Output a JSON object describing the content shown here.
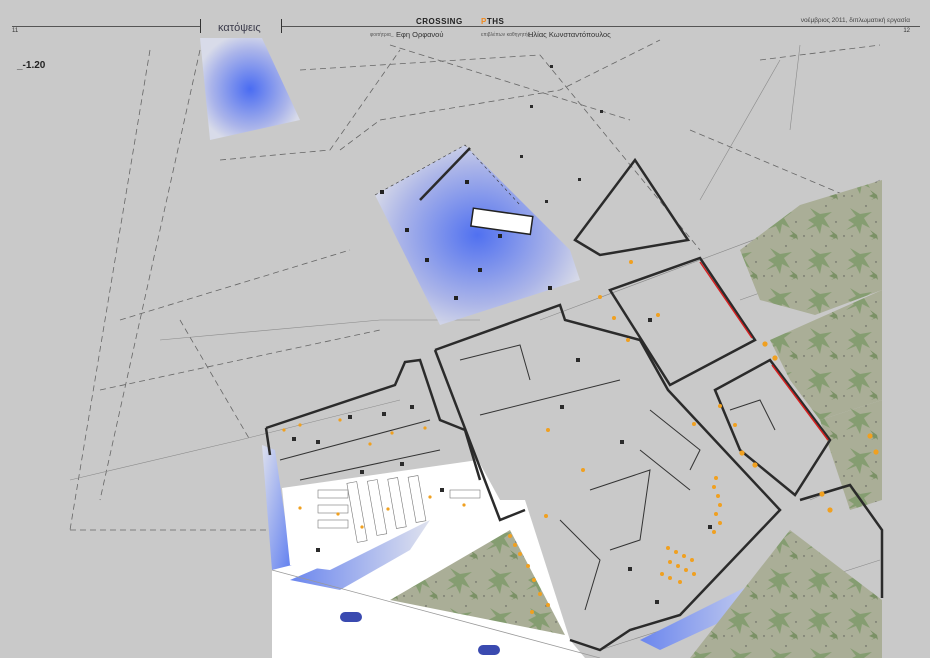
{
  "header": {
    "page_left": "11",
    "page_right": "12",
    "section_title": "κατόψεις",
    "project_word1": "CROSSING",
    "project_word2_prefix": "P",
    "project_word2_rest": "THS",
    "student_label": "φοιτήτρια_",
    "student_name": "Εφη Ορφανού",
    "supervisor_label": "επιβλέπων καθηγητής_",
    "supervisor_name": "Ηλίας Κωνσταντόπουλος",
    "date_text": "νοέμβριος 2011, διπλωματική εργασία"
  },
  "plan": {
    "level_label": "_-1.20"
  },
  "colors": {
    "background": "#c9c9c9",
    "accent_orange": "#f0a020",
    "blue_glass": "#5a7cf0",
    "wall": "#2b2b2b",
    "green_zone": "#a9ad96",
    "red_edge": "#d42020"
  }
}
